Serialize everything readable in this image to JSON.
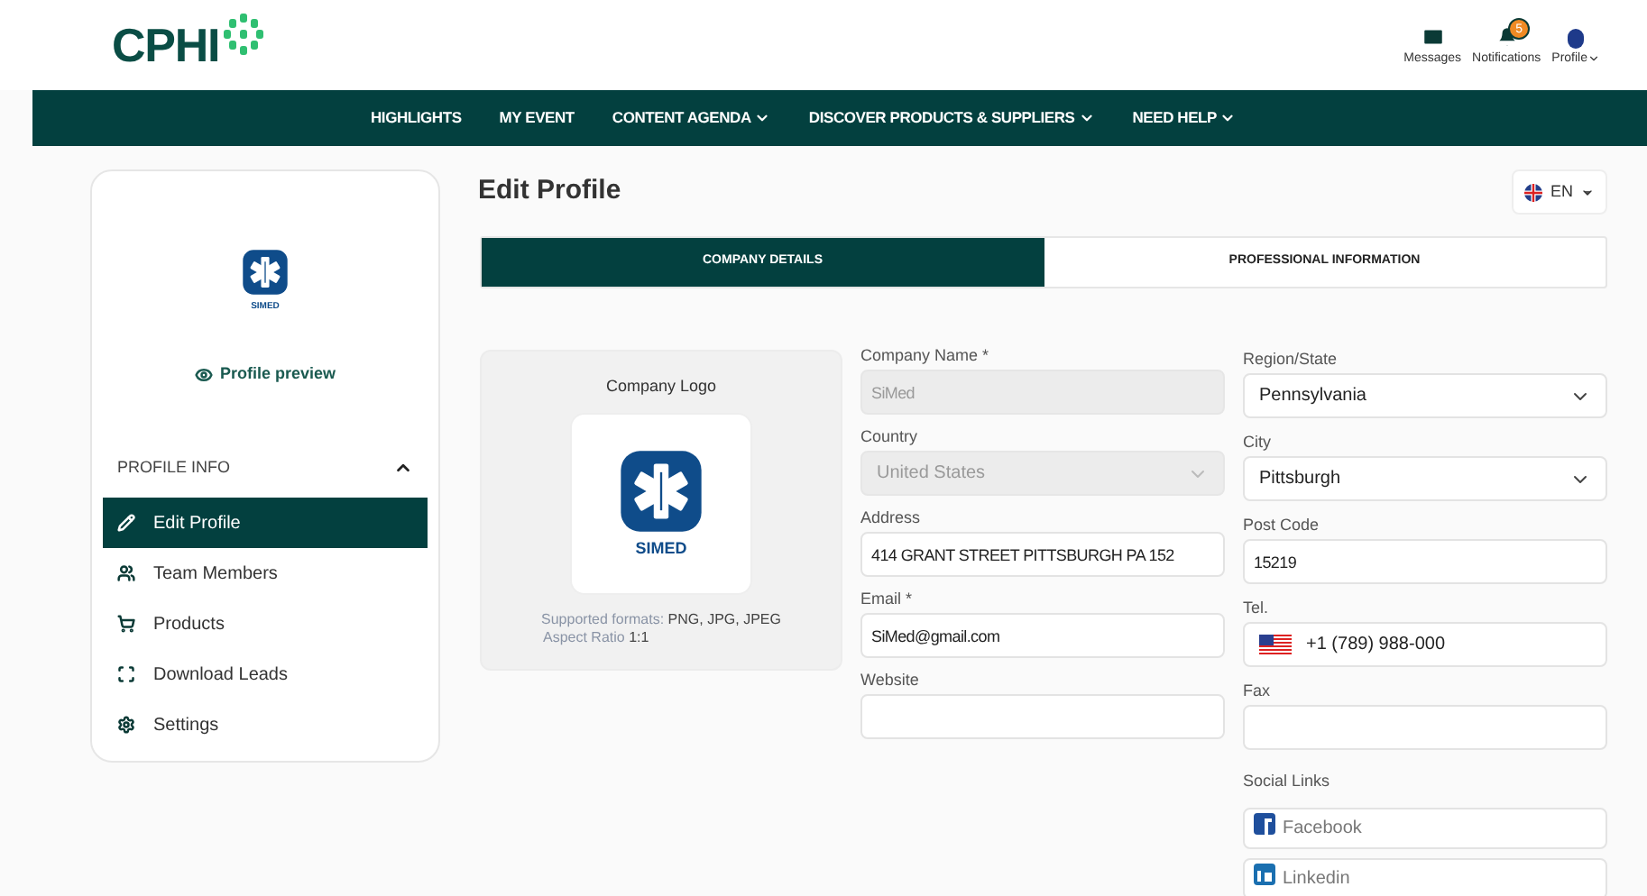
{
  "header": {
    "logo": "CPHI",
    "actions": [
      {
        "label": "Messages",
        "dropdown": false
      },
      {
        "label": "Notifications",
        "badge": "5",
        "dropdown": false
      },
      {
        "label": "Profile",
        "dropdown": true
      }
    ]
  },
  "nav": [
    {
      "label": "HIGHLIGHTS",
      "dropdown": false
    },
    {
      "label": "MY EVENT",
      "dropdown": false
    },
    {
      "label": "CONTENT AGENDA",
      "dropdown": true
    },
    {
      "label": "DISCOVER PRODUCTS & SUPPLIERS",
      "dropdown": true
    },
    {
      "label": "NEED HELP",
      "dropdown": true
    }
  ],
  "sidebar": {
    "logo_text": "SIMED",
    "preview": "Profile preview",
    "section": {
      "title": "PROFILE INFO",
      "expanded": true
    },
    "items": [
      {
        "label": "Edit Profile",
        "selected": true
      },
      {
        "label": "Team Members",
        "selected": false
      },
      {
        "label": "Products",
        "selected": false
      },
      {
        "label": "Download Leads",
        "selected": false
      },
      {
        "label": "Settings",
        "selected": false
      }
    ]
  },
  "page": {
    "title": "Edit Profile",
    "language": "EN"
  },
  "tabs": [
    {
      "label": "COMPANY DETAILS",
      "selected": true
    },
    {
      "label": "PROFESSIONAL INFORMATION",
      "selected": false
    }
  ],
  "logo_card": {
    "title": "Company Logo",
    "logo_text": "SIMED",
    "formats_label": "Supported formats:",
    "formats": "PNG, JPG, JPEG",
    "ratio_label": "Aspect Ratio",
    "ratio": "1:1"
  },
  "left_fields": [
    {
      "label": "Company Name *",
      "kind": "text",
      "value": "SiMed",
      "disabled": true
    },
    {
      "label": "Country",
      "kind": "select",
      "value": "United States",
      "disabled": true
    },
    {
      "label": "Address",
      "kind": "text",
      "value": "414 GRANT STREET PITTSBURGH PA 152",
      "disabled": false
    },
    {
      "label": "Email *",
      "kind": "text",
      "value": "SiMed@gmail.com",
      "disabled": false
    },
    {
      "label": "Website",
      "kind": "text",
      "disabled": false
    }
  ],
  "right_fields": [
    {
      "label": "Region/State",
      "kind": "select",
      "value": "Pennsylvania",
      "disabled": false
    },
    {
      "label": "City",
      "kind": "select",
      "value": "Pittsburgh",
      "disabled": false
    },
    {
      "label": "Post Code",
      "kind": "text",
      "value": "15219",
      "disabled": false
    },
    {
      "label": "Tel.",
      "kind": "phone",
      "value": "+1 (789) 988-000",
      "disabled": false
    },
    {
      "label": "Fax",
      "kind": "text",
      "disabled": false
    }
  ],
  "social": {
    "title": "Social Links",
    "links": [
      {
        "kind": "facebook",
        "placeholder": "Facebook"
      },
      {
        "kind": "linkedin",
        "placeholder": "Linkedin"
      }
    ]
  }
}
